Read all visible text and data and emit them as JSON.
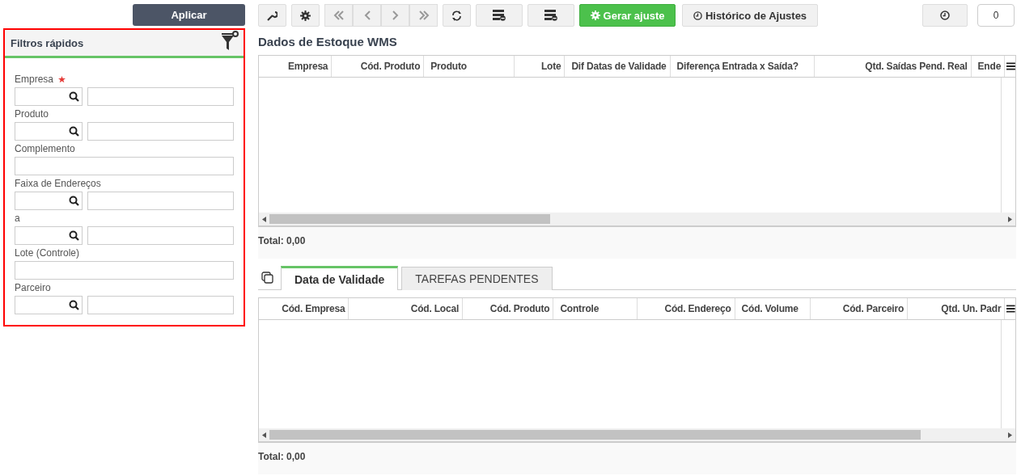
{
  "apply_button": "Aplicar",
  "filter_panel": {
    "title": "Filtros rápidos",
    "fields": [
      {
        "label": "Empresa",
        "required": true,
        "kind": "lookup"
      },
      {
        "label": "Produto",
        "required": false,
        "kind": "lookup"
      },
      {
        "label": "Complemento",
        "required": false,
        "kind": "text"
      },
      {
        "label": "Faixa de Endereços",
        "required": false,
        "kind": "lookup"
      },
      {
        "label": "a",
        "required": false,
        "kind": "lookup"
      },
      {
        "label": "Lote (Controle)",
        "required": false,
        "kind": "text"
      },
      {
        "label": "Parceiro",
        "required": false,
        "kind": "lookup"
      }
    ]
  },
  "toolbar": {
    "generate_button": "Gerar ajuste",
    "history_button": "Histórico de Ajustes",
    "counter": "0"
  },
  "main_grid": {
    "title": "Dados de Estoque WMS",
    "columns": [
      {
        "label": "Empresa"
      },
      {
        "label": "Cód. Produto"
      },
      {
        "label": "Produto"
      },
      {
        "label": "Lote"
      },
      {
        "label": "Dif Datas de Validade"
      },
      {
        "label": "Diferença Entrada x Saída?"
      },
      {
        "label": "Qtd. Saídas Pend. Real"
      },
      {
        "label": "Ende"
      }
    ],
    "total": "Total: 0,00"
  },
  "tabs": [
    {
      "label": "Data de Validade",
      "selected": true
    },
    {
      "label": "TAREFAS PENDENTES",
      "selected": false
    }
  ],
  "detail_grid": {
    "columns": [
      {
        "label": "Cód. Empresa"
      },
      {
        "label": "Cód. Local"
      },
      {
        "label": "Cód. Produto"
      },
      {
        "label": "Controle"
      },
      {
        "label": "Cód. Endereço"
      },
      {
        "label": "Cód. Volume"
      },
      {
        "label": "Cód. Parceiro"
      },
      {
        "label": "Qtd. Un. Padr"
      }
    ],
    "total": "Total: 0,00"
  }
}
